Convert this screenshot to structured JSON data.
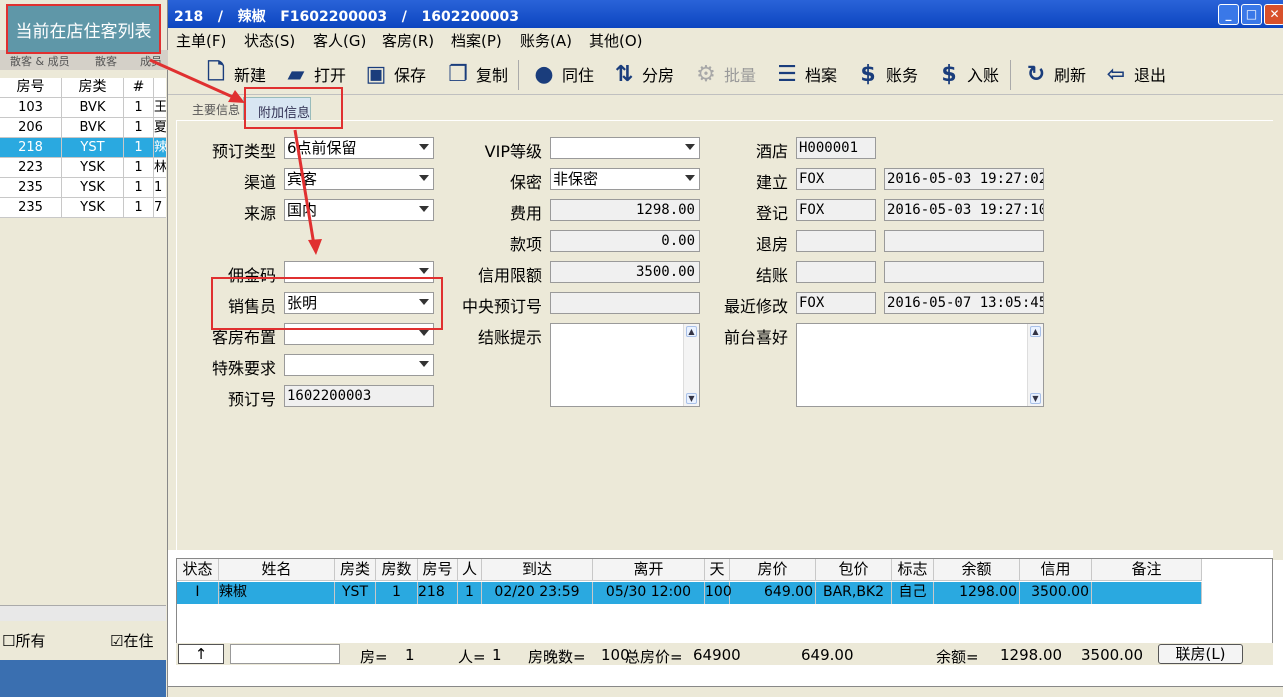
{
  "callout": "当前在店住客列表",
  "left": {
    "tabs": [
      "散客 & 成员",
      "散客",
      "成员"
    ],
    "headers": [
      "房号",
      "房类",
      "#"
    ],
    "rows": [
      {
        "room": "103",
        "type": "BVK",
        "n": "1",
        "x": "王"
      },
      {
        "room": "206",
        "type": "BVK",
        "n": "1",
        "x": "夏"
      },
      {
        "room": "218",
        "type": "YST",
        "n": "1",
        "x": "辣"
      },
      {
        "room": "223",
        "type": "YSK",
        "n": "1",
        "x": "林"
      },
      {
        "room": "235",
        "type": "YSK",
        "n": "1",
        "x": "1"
      },
      {
        "room": "235",
        "type": "YSK",
        "n": "1",
        "x": "7"
      }
    ],
    "chk_all": "所有",
    "chk_in": "在住"
  },
  "title": "218   /   辣椒   F1602200003   /   1602200003",
  "menu": [
    "主单(F)",
    "状态(S)",
    "客人(G)",
    "客房(R)",
    "档案(P)",
    "账务(A)",
    "其他(O)"
  ],
  "toolbar": {
    "new": "新建",
    "open": "打开",
    "save": "保存",
    "copy": "复制",
    "share": "同住",
    "split": "分房",
    "batch": "批量",
    "profile": "档案",
    "account": "账务",
    "post": "入账",
    "refresh": "刷新",
    "exit": "退出"
  },
  "tabs": {
    "main": "主要信息",
    "extra": "附加信息"
  },
  "form": {
    "book_type_label": "预订类型",
    "book_type": "6点前保留",
    "channel_label": "渠道",
    "channel": "宾客",
    "source_label": "来源",
    "source": "国内",
    "commission_label": "佣金码",
    "commission": "",
    "sales_label": "销售员",
    "sales": "张明",
    "room_setup_label": "客房布置",
    "room_setup": "",
    "special_label": "特殊要求",
    "special": "",
    "booking_no_label": "预订号",
    "booking_no": "1602200003",
    "vip_label": "VIP等级",
    "vip": "",
    "secret_label": "保密",
    "secret": "非保密",
    "fee_label": "费用",
    "fee": "1298.00",
    "payment_label": "款项",
    "payment": "0.00",
    "credit_label": "信用限额",
    "credit": "3500.00",
    "central_label": "中央预订号",
    "central": "",
    "checkout_tip_label": "结账提示",
    "hotel_label": "酒店",
    "hotel": "H000001",
    "created_label": "建立",
    "created_by": "FOX",
    "created_at": "2016-05-03 19:27:02",
    "registered_label": "登记",
    "registered_by": "FOX",
    "registered_at": "2016-05-03 19:27:10",
    "checkout_label": "退房",
    "settle_label": "结账",
    "modified_label": "最近修改",
    "modified_by": "FOX",
    "modified_at": "2016-05-07 13:05:45",
    "pref_label": "前台喜好"
  },
  "grid": {
    "headers": [
      "状态",
      "姓名",
      "房类",
      "房数",
      "房号",
      "人",
      "到达",
      "离开",
      "天",
      "房价",
      "包价",
      "标志",
      "余额",
      "信用",
      "备注"
    ],
    "row": [
      "I",
      "辣椒",
      "YST",
      "1",
      "218",
      "1",
      "02/20 23:59",
      "05/30 12:00",
      "100",
      "649.00",
      "BAR,BK2",
      "自己",
      "1298.00",
      "3500.00",
      ""
    ]
  },
  "summary": {
    "up": "↑",
    "rooms_label": "房=",
    "rooms": "1",
    "persons_label": "人=",
    "persons": "1",
    "nights_label": "房晚数=",
    "nights": "100",
    "total_label": "总房价=",
    "total": "64900",
    "rate": "649.00",
    "balance_label": "余额=",
    "balance": "1298.00",
    "credit": "3500.00",
    "link_button": "联房(L)"
  },
  "colors": {
    "selected_row": "#2aa9e0",
    "callout_bg": "#5f97a8",
    "annotation_red": "#e03030"
  }
}
